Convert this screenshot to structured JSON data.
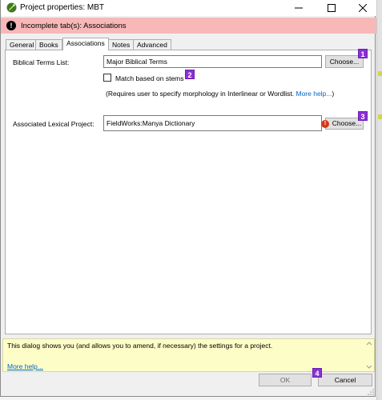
{
  "window": {
    "title": "Project properties: MBT",
    "minimize_icon": "minimize-icon",
    "maximize_icon": "maximize-icon",
    "close_icon": "close-icon"
  },
  "error_banner": {
    "text": "Incomplete tab(s): Associations",
    "icon": "error-icon",
    "color": "#f8b8b8"
  },
  "tabs": [
    {
      "label": "General",
      "active": false
    },
    {
      "label": "Books",
      "active": false
    },
    {
      "label": "Associations",
      "active": true
    },
    {
      "label": "Notes",
      "active": false
    },
    {
      "label": "Advanced",
      "active": false
    }
  ],
  "associations": {
    "biblical_terms_label": "Biblical Terms List:",
    "biblical_terms_value": "Major Biblical Terms",
    "choose_label": "Choose...",
    "match_stems_label": "Match based on stems",
    "match_stems_checked": false,
    "requires_note": "(Requires user to specify morphology in Interlinear or Wordlist.",
    "more_help_inline": "More help...",
    "close_paren": ")",
    "lexical_project_label": "Associated Lexical Project:",
    "lexical_project_value": "FieldWorks:Manya Dictionary",
    "choose_label_2": "Choose...",
    "warning_icon": "warning-icon"
  },
  "badges": [
    "1",
    "2",
    "3",
    "4"
  ],
  "badge_color": "#8b2fd6",
  "info": {
    "text": "This dialog shows you (and allows you to amend, if necessary) the settings for a project.",
    "more_help": "More help...",
    "background": "#fdfdc8"
  },
  "buttons": {
    "ok": "OK",
    "cancel": "Cancel"
  }
}
